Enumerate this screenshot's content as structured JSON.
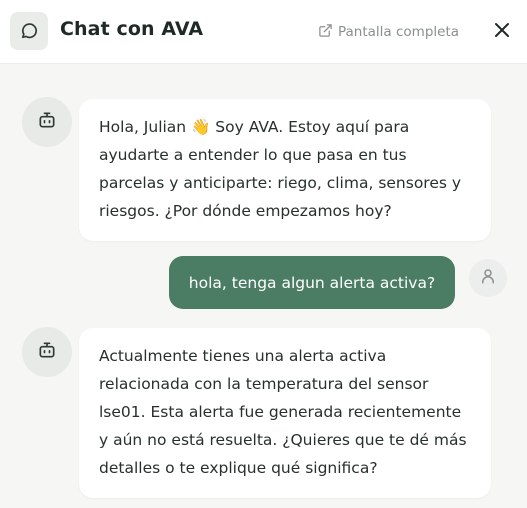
{
  "header": {
    "title": "Chat con AVA",
    "chat_icon": "chat-bubble-icon",
    "fullscreen_icon": "external-link-icon",
    "fullscreen_label": "Pantalla completa",
    "close_icon": "close-icon"
  },
  "messages": [
    {
      "role": "assistant",
      "avatar_icon": "robot-icon",
      "lines": [
        "Hola, Julian 👋 Soy AVA. Estoy aquí para",
        "ayudarte a entender lo que pasa en tus",
        "parcelas y anticiparte: riego, clima, sensores y",
        "riesgos. ¿Por dónde empezamos hoy?"
      ]
    },
    {
      "role": "user",
      "avatar_icon": "user-icon",
      "text": "hola, tenga algun alerta activa?"
    },
    {
      "role": "assistant",
      "avatar_icon": "robot-icon",
      "lines": [
        "Actualmente tienes una alerta activa",
        "relacionada con la temperatura del sensor",
        "lse01. Esta alerta fue generada recientemente",
        "y aún no está resuelta. ¿Quieres que te dé más",
        "detalles o te explique qué significa?"
      ]
    }
  ],
  "colors": {
    "accent": "#4a7d63",
    "background": "#f6f6f4",
    "bubble": "#ffffff"
  }
}
